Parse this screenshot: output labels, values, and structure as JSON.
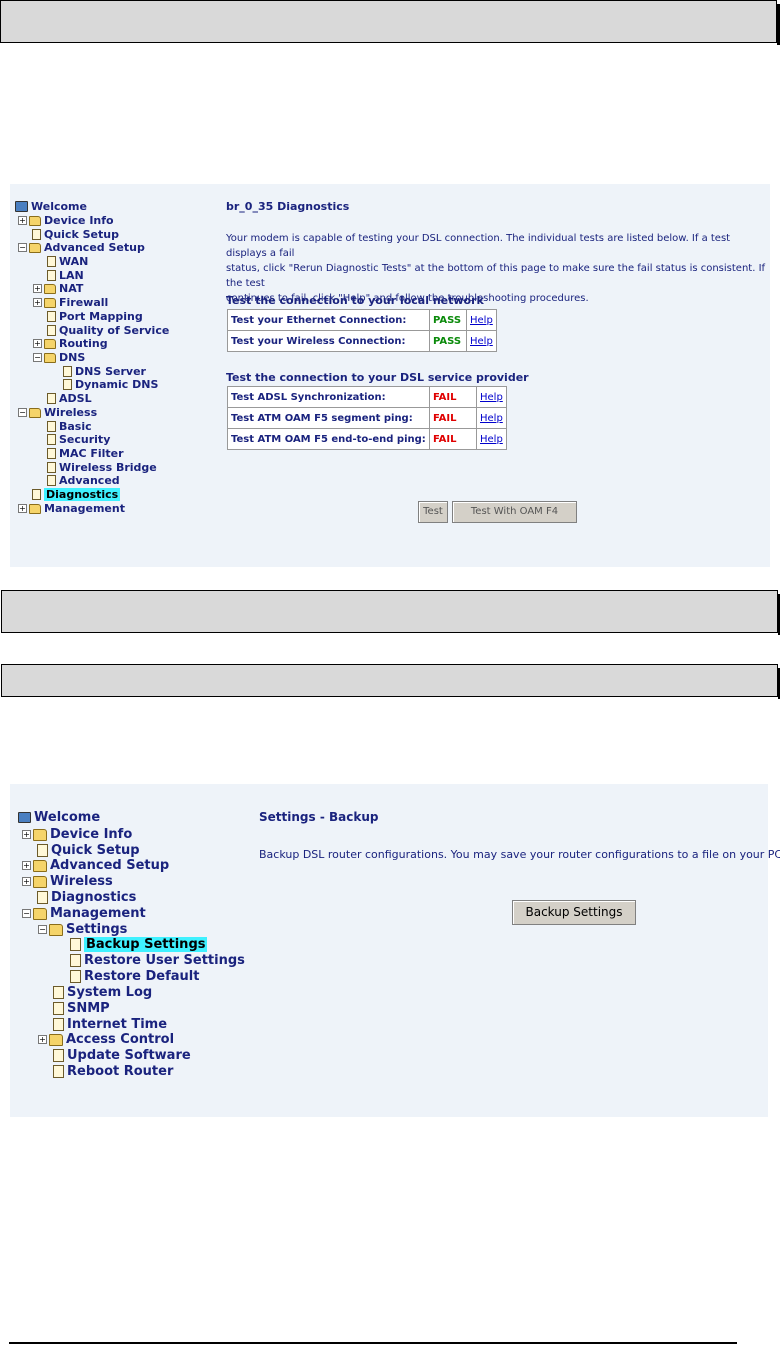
{
  "diagnostics": {
    "tree": {
      "welcome": "Welcome",
      "device_info": "Device Info",
      "quick_setup": "Quick Setup",
      "advanced_setup": "Advanced Setup",
      "wan": "WAN",
      "lan": "LAN",
      "nat": "NAT",
      "firewall": "Firewall",
      "port_mapping": "Port Mapping",
      "quality_of_service": "Quality of Service",
      "routing": "Routing",
      "dns": "DNS",
      "dns_server": "DNS Server",
      "dynamic_dns": "Dynamic DNS",
      "adsl": "ADSL",
      "wireless": "Wireless",
      "basic": "Basic",
      "security": "Security",
      "mac_filter": "MAC Filter",
      "wireless_bridge": "Wireless Bridge",
      "advanced": "Advanced",
      "diagnostics": "Diagnostics",
      "management": "Management"
    },
    "title": "br_0_35 Diagnostics",
    "desc": [
      "Your modem is capable of testing your DSL connection. The individual tests are listed below. If a test displays a fail",
      "status, click \"Rerun Diagnostic Tests\" at the bottom of this page to make sure the fail status is consistent. If the test",
      "continues to fail, click \"Help\" and follow the troubleshooting procedures."
    ],
    "local_section": "Test the connection to your local network",
    "local_tests": [
      {
        "name": "Test your Ethernet Connection:",
        "result": "PASS",
        "help": "Help"
      },
      {
        "name": "Test your Wireless Connection:",
        "result": "PASS",
        "help": "Help"
      }
    ],
    "dsl_section": "Test the connection to your DSL service provider",
    "dsl_tests": [
      {
        "name": "Test ADSL Synchronization:",
        "result": "FAIL",
        "help": "Help"
      },
      {
        "name": "Test ATM OAM F5 segment ping:",
        "result": "FAIL",
        "help": "Help"
      },
      {
        "name": "Test ATM OAM F5 end-to-end ping:",
        "result": "FAIL",
        "help": "Help"
      }
    ],
    "btn_test": "Test",
    "btn_test_oam": "Test With OAM F4"
  },
  "backup": {
    "tree": {
      "welcome": "Welcome",
      "device_info": "Device Info",
      "quick_setup": "Quick Setup",
      "advanced_setup": "Advanced Setup",
      "wireless": "Wireless",
      "diagnostics": "Diagnostics",
      "management": "Management",
      "settings": "Settings",
      "backup_settings": "Backup Settings",
      "restore_user_settings": "Restore User Settings",
      "restore_default": "Restore Default",
      "system_log": "System Log",
      "snmp": "SNMP",
      "internet_time": "Internet Time",
      "access_control": "Access Control",
      "update_software": "Update Software",
      "reboot_router": "Reboot Router"
    },
    "title": "Settings - Backup",
    "desc": "Backup DSL router configurations. You may save your router configurations to a file on your PC.",
    "btn_backup": "Backup Settings"
  }
}
